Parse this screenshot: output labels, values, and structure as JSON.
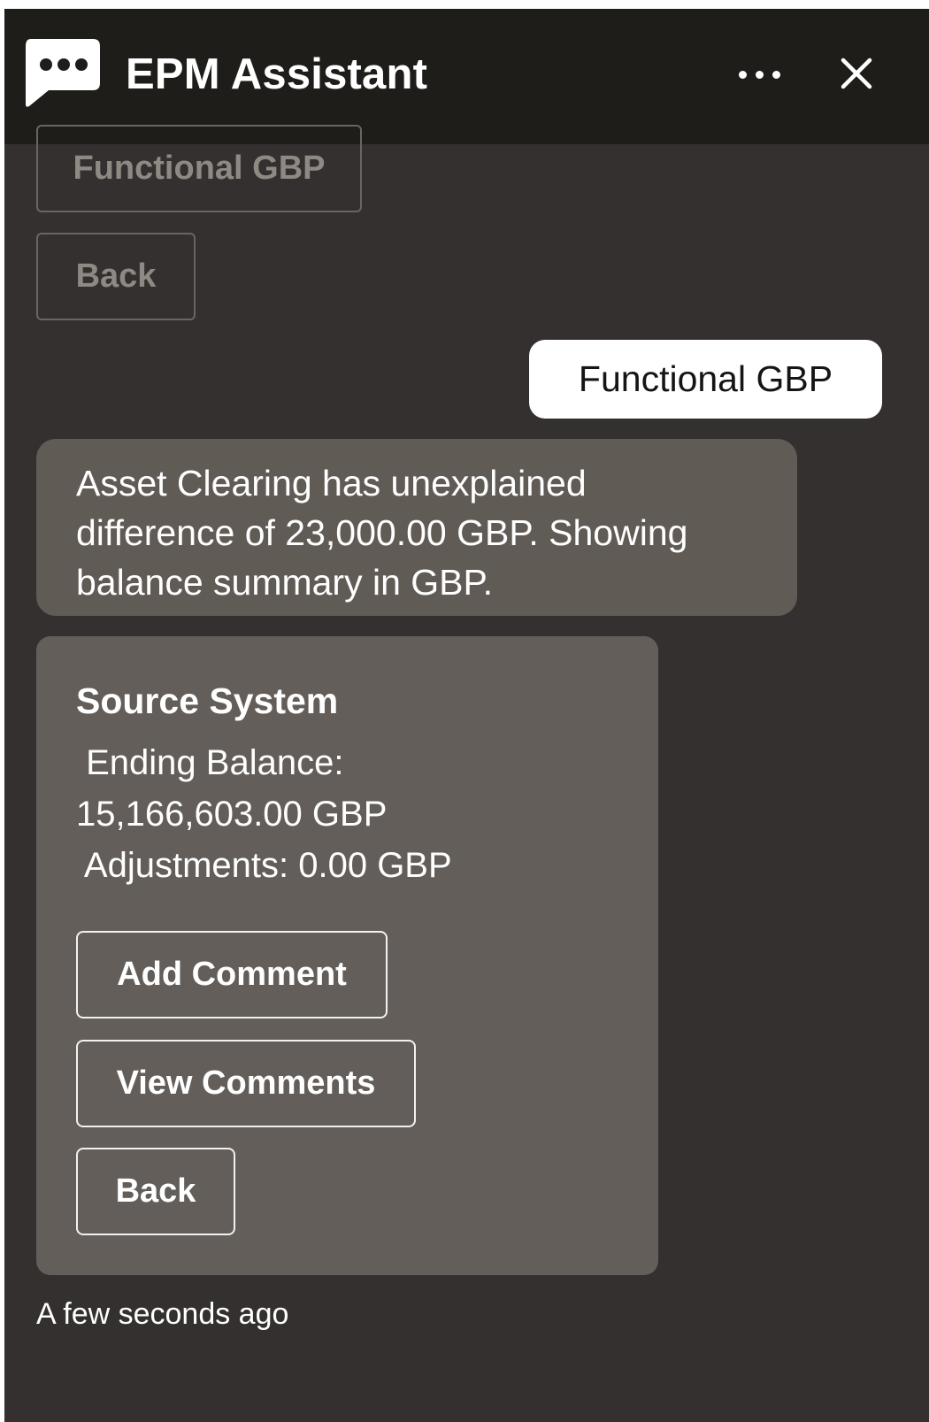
{
  "header": {
    "title": "EPM Assistant",
    "icons": {
      "logo": "chat-bubble-icon",
      "more": "more-horizontal-icon",
      "close": "close-icon"
    }
  },
  "history": {
    "functional_button_label": "Functional GBP",
    "back_button_label": "Back"
  },
  "user_message": {
    "text": "Functional GBP"
  },
  "bot_message": {
    "line1": "Asset Clearing has unexplained",
    "line2": "difference of 23,000.00 GBP. Showing",
    "line3": "balance summary in GBP."
  },
  "card": {
    "title": "Source System",
    "ending_balance_label": " Ending Balance:",
    "ending_balance_value": "15,166,603.00 GBP",
    "adjustments": " Adjustments: 0.00 GBP",
    "actions": {
      "add_comment": "Add Comment",
      "view_comments": "View Comments",
      "back": "Back"
    }
  },
  "timestamp": "A few seconds ago",
  "colors": {
    "panel_bg": "#353030",
    "header_bg": "#1e1d1a",
    "bot_bubble_bg": "#615b56",
    "card_bg": "#635e59",
    "user_bubble_bg": "#ffffff"
  }
}
